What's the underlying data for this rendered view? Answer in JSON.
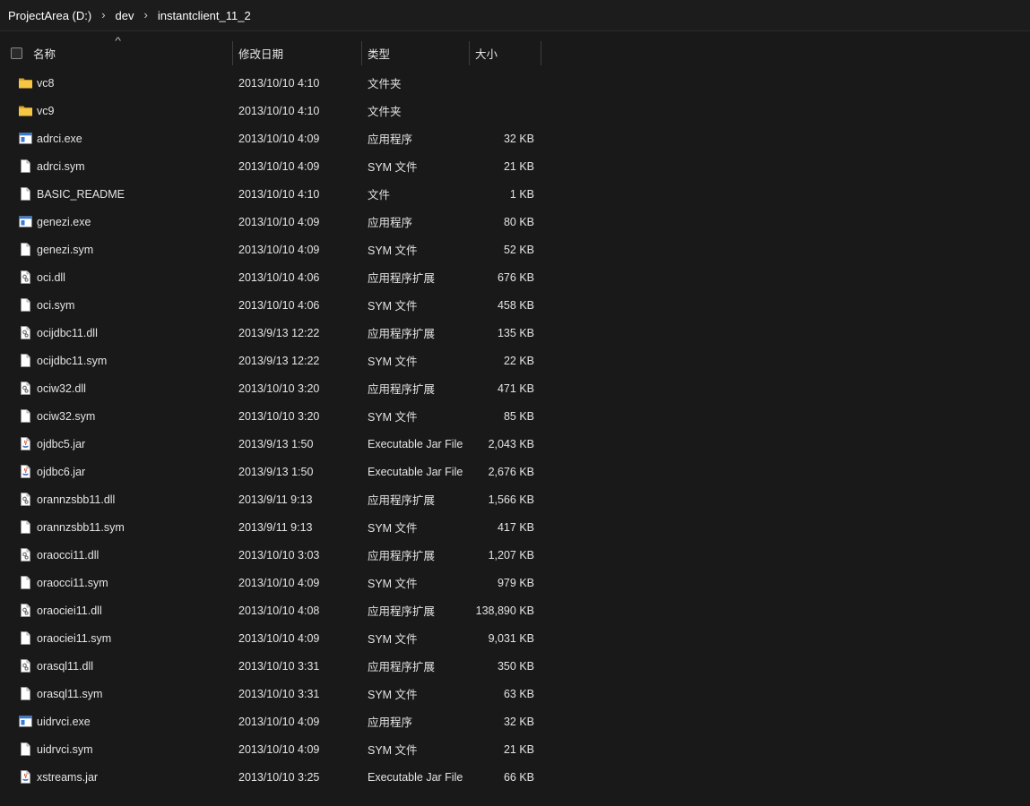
{
  "breadcrumb": {
    "items": [
      "ProjectArea (D:)",
      "dev",
      "instantclient_11_2"
    ],
    "separator": "›"
  },
  "header": {
    "name": "名称",
    "date": "修改日期",
    "type": "类型",
    "size": "大小",
    "sort_indicator": "^"
  },
  "colors": {
    "background": "#191919",
    "text": "#e4e4e4",
    "folder": "#f0c23b",
    "exe_accent": "#3a7bd5"
  },
  "files": [
    {
      "name": "vc8",
      "date": "2013/10/10 4:10",
      "type": "文件夹",
      "size": "",
      "icon": "folder-icon"
    },
    {
      "name": "vc9",
      "date": "2013/10/10 4:10",
      "type": "文件夹",
      "size": "",
      "icon": "folder-icon"
    },
    {
      "name": "adrci.exe",
      "date": "2013/10/10 4:09",
      "type": "应用程序",
      "size": "32 KB",
      "icon": "exe-icon"
    },
    {
      "name": "adrci.sym",
      "date": "2013/10/10 4:09",
      "type": "SYM 文件",
      "size": "21 KB",
      "icon": "file-icon"
    },
    {
      "name": "BASIC_README",
      "date": "2013/10/10 4:10",
      "type": "文件",
      "size": "1 KB",
      "icon": "file-icon"
    },
    {
      "name": "genezi.exe",
      "date": "2013/10/10 4:09",
      "type": "应用程序",
      "size": "80 KB",
      "icon": "exe-icon"
    },
    {
      "name": "genezi.sym",
      "date": "2013/10/10 4:09",
      "type": "SYM 文件",
      "size": "52 KB",
      "icon": "file-icon"
    },
    {
      "name": "oci.dll",
      "date": "2013/10/10 4:06",
      "type": "应用程序扩展",
      "size": "676 KB",
      "icon": "dll-icon"
    },
    {
      "name": "oci.sym",
      "date": "2013/10/10 4:06",
      "type": "SYM 文件",
      "size": "458 KB",
      "icon": "file-icon"
    },
    {
      "name": "ocijdbc11.dll",
      "date": "2013/9/13 12:22",
      "type": "应用程序扩展",
      "size": "135 KB",
      "icon": "dll-icon"
    },
    {
      "name": "ocijdbc11.sym",
      "date": "2013/9/13 12:22",
      "type": "SYM 文件",
      "size": "22 KB",
      "icon": "file-icon"
    },
    {
      "name": "ociw32.dll",
      "date": "2013/10/10 3:20",
      "type": "应用程序扩展",
      "size": "471 KB",
      "icon": "dll-icon"
    },
    {
      "name": "ociw32.sym",
      "date": "2013/10/10 3:20",
      "type": "SYM 文件",
      "size": "85 KB",
      "icon": "file-icon"
    },
    {
      "name": "ojdbc5.jar",
      "date": "2013/9/13 1:50",
      "type": "Executable Jar File",
      "size": "2,043 KB",
      "icon": "jar-icon"
    },
    {
      "name": "ojdbc6.jar",
      "date": "2013/9/13 1:50",
      "type": "Executable Jar File",
      "size": "2,676 KB",
      "icon": "jar-icon"
    },
    {
      "name": "orannzsbb11.dll",
      "date": "2013/9/11 9:13",
      "type": "应用程序扩展",
      "size": "1,566 KB",
      "icon": "dll-icon"
    },
    {
      "name": "orannzsbb11.sym",
      "date": "2013/9/11 9:13",
      "type": "SYM 文件",
      "size": "417 KB",
      "icon": "file-icon"
    },
    {
      "name": "oraocci11.dll",
      "date": "2013/10/10 3:03",
      "type": "应用程序扩展",
      "size": "1,207 KB",
      "icon": "dll-icon"
    },
    {
      "name": "oraocci11.sym",
      "date": "2013/10/10 4:09",
      "type": "SYM 文件",
      "size": "979 KB",
      "icon": "file-icon"
    },
    {
      "name": "oraociei11.dll",
      "date": "2013/10/10 4:08",
      "type": "应用程序扩展",
      "size": "138,890 KB",
      "icon": "dll-icon"
    },
    {
      "name": "oraociei11.sym",
      "date": "2013/10/10 4:09",
      "type": "SYM 文件",
      "size": "9,031 KB",
      "icon": "file-icon"
    },
    {
      "name": "orasql11.dll",
      "date": "2013/10/10 3:31",
      "type": "应用程序扩展",
      "size": "350 KB",
      "icon": "dll-icon"
    },
    {
      "name": "orasql11.sym",
      "date": "2013/10/10 3:31",
      "type": "SYM 文件",
      "size": "63 KB",
      "icon": "file-icon"
    },
    {
      "name": "uidrvci.exe",
      "date": "2013/10/10 4:09",
      "type": "应用程序",
      "size": "32 KB",
      "icon": "exe-icon"
    },
    {
      "name": "uidrvci.sym",
      "date": "2013/10/10 4:09",
      "type": "SYM 文件",
      "size": "21 KB",
      "icon": "file-icon"
    },
    {
      "name": "xstreams.jar",
      "date": "2013/10/10 3:25",
      "type": "Executable Jar File",
      "size": "66 KB",
      "icon": "jar-icon"
    }
  ]
}
